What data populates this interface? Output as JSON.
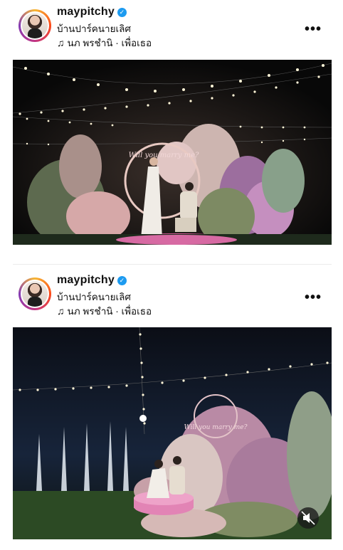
{
  "posts": [
    {
      "username": "maypitchy",
      "location": "บ้านปาร์คนายเลิศ",
      "music": "นภ พรชำนิ · เพื่อเธอ",
      "more_icon": "more-horizontal-icon",
      "photo_text": "Will you marry me?"
    },
    {
      "username": "maypitchy",
      "location": "บ้านปาร์คนายเลิศ",
      "music": "นภ พรชำนิ · เพื่อเธอ",
      "more_icon": "more-horizontal-icon",
      "photo_text": "Will you marry me?",
      "mute_icon": "muted-speaker-icon"
    }
  ],
  "colors": {
    "verified": "#1d9bf0",
    "avatar_ring": "#c13584"
  }
}
